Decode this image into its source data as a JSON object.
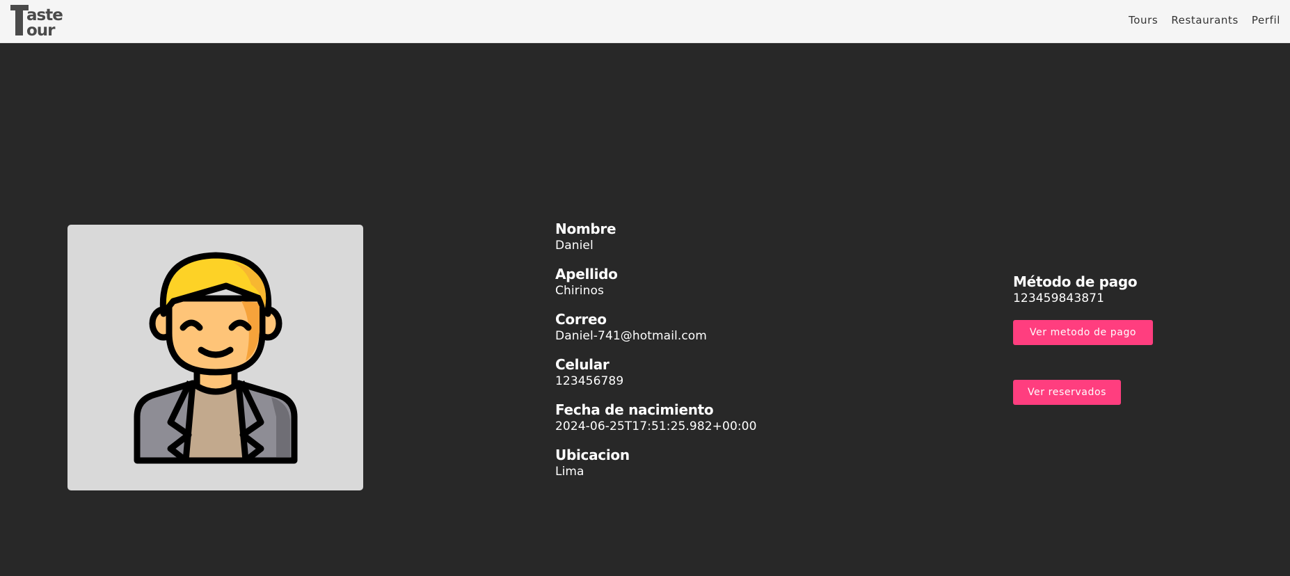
{
  "brand": {
    "logo_line1": "Taste",
    "logo_line2": "Tour",
    "logo_color": "#4a4a4a"
  },
  "nav": {
    "items": [
      {
        "label": "Tours"
      },
      {
        "label": "Restaurants"
      },
      {
        "label": "Perfil"
      }
    ]
  },
  "avatar": {
    "icon": "user-avatar-icon",
    "background": "#d9d9d9",
    "hair_color": "#fdd226",
    "skin_color": "#fec478",
    "jacket_color": "#8e8d95",
    "shirt_color": "#c2a98d"
  },
  "profile": {
    "fields": [
      {
        "label": "Nombre",
        "value": "Daniel"
      },
      {
        "label": "Apellido",
        "value": "Chirinos"
      },
      {
        "label": "Correo",
        "value": "Daniel-741@hotmail.com"
      },
      {
        "label": "Celular",
        "value": "123456789"
      },
      {
        "label": "Fecha de nacimiento",
        "value": "2024-06-25T17:51:25.982+00:00"
      },
      {
        "label": "Ubicacion",
        "value": "Lima"
      }
    ]
  },
  "payment": {
    "label": "Método de pago",
    "value": "123459843871",
    "view_button": "Ver metodo de pago",
    "reserved_button": "Ver reservados"
  },
  "colors": {
    "background": "#282828",
    "navbar": "#f5f5f5",
    "accent": "#ff3e7f"
  }
}
